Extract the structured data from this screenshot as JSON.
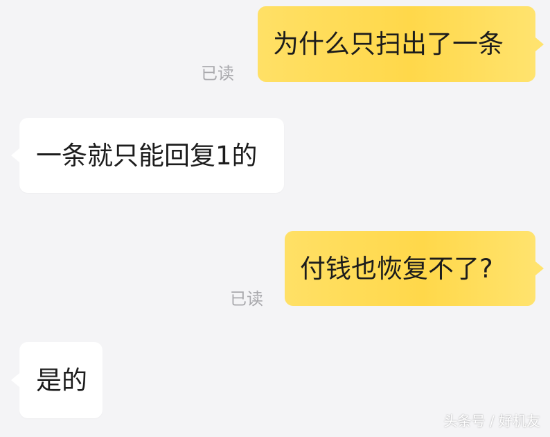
{
  "messages": [
    {
      "direction": "outgoing",
      "text": "为什么只扫出了一条",
      "status": "已读"
    },
    {
      "direction": "incoming",
      "text": "一条就只能回复1的"
    },
    {
      "direction": "outgoing",
      "text": "付钱也恢复不了?",
      "status": "已读"
    },
    {
      "direction": "incoming",
      "text": "是的"
    }
  ],
  "watermark": "头条号 / 好机友",
  "colors": {
    "background": "#f4f4f6",
    "outgoing_bubble": "#ffd84a",
    "incoming_bubble": "#ffffff",
    "read_status": "#a9a9ad"
  }
}
